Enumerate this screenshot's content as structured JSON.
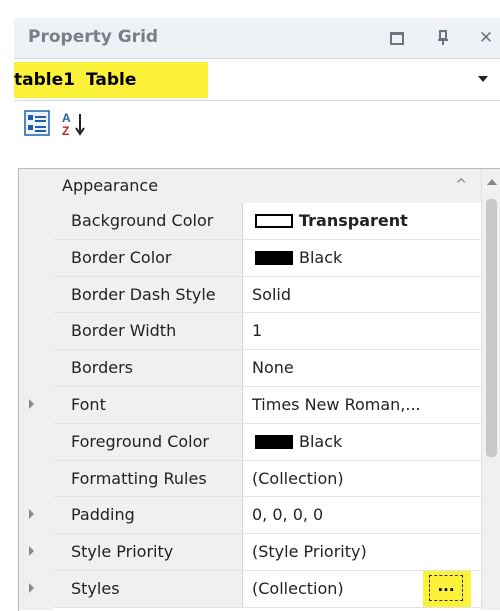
{
  "titlebar": {
    "title": "Property Grid",
    "maximize_icon": "maximize-icon",
    "pin_icon": "pin-icon",
    "close_glyph": "✕"
  },
  "selector": {
    "object_name": "table1",
    "object_type": "Table",
    "highlight_color": "#fcf23a"
  },
  "toolbar": {
    "categorized_icon": "categorized-view-icon",
    "alphabetical_icon": "sort-alphabetical-icon"
  },
  "category": {
    "label": "Appearance",
    "chevron": "^"
  },
  "properties": [
    {
      "name": "Background Color",
      "value": "Transparent",
      "swatch": "empty",
      "bold": true
    },
    {
      "name": "Border Color",
      "value": "Black",
      "swatch": "black"
    },
    {
      "name": "Border Dash Style",
      "value": "Solid"
    },
    {
      "name": "Border Width",
      "value": "1"
    },
    {
      "name": "Borders",
      "value": "None"
    },
    {
      "name": "Font",
      "value": "Times New Roman,...",
      "expandable": true
    },
    {
      "name": "Foreground Color",
      "value": "Black",
      "swatch": "black"
    },
    {
      "name": "Formatting Rules",
      "value": "(Collection)"
    },
    {
      "name": "Padding",
      "value": "0, 0, 0, 0",
      "expandable": true
    },
    {
      "name": "Style Priority",
      "value": "(Style Priority)",
      "expandable": true
    },
    {
      "name": "Styles",
      "value": "(Collection)",
      "expandable": true,
      "ellipsis": "..."
    }
  ]
}
